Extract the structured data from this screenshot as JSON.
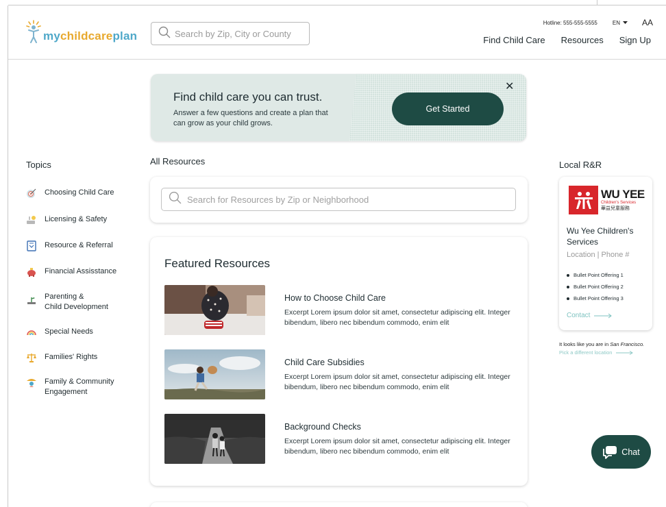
{
  "header": {
    "logo": {
      "part1": "my",
      "part2": "childcare",
      "part3": "plan"
    },
    "search_placeholder": "Search by Zip, City or County",
    "hotline": "Hotline: 555-555-5555",
    "language": "EN",
    "text_size": "AA",
    "nav": [
      "Find Child Care",
      "Resources",
      "Sign Up"
    ]
  },
  "banner": {
    "title": "Find child care you can trust.",
    "text": "Answer a few questions and create a plan that can grow as your child grows.",
    "cta": "Get Started",
    "close": "✕"
  },
  "topics": {
    "title": "Topics",
    "items": [
      {
        "label": "Choosing Child Care",
        "icon": "target-icon"
      },
      {
        "label": "Licensing & Safety",
        "icon": "license-icon"
      },
      {
        "label": "Resource & Referral",
        "icon": "referral-icon"
      },
      {
        "label": "Financial Assisstance",
        "icon": "piggy-bank-icon"
      },
      {
        "label": "Parenting &\nChild Development",
        "icon": "plant-icon"
      },
      {
        "label": "Special Needs",
        "icon": "rainbow-icon"
      },
      {
        "label": "Families' Rights",
        "icon": "scales-icon"
      },
      {
        "label": "Family & Community\nEngagement",
        "icon": "community-icon"
      }
    ]
  },
  "resources": {
    "title": "All Resources",
    "search_placeholder": "Search for Resources by Zip or Neighborhood",
    "featured_title": "Featured Resources",
    "articles": [
      {
        "title": "How to Choose Child Care",
        "text": "Excerpt Lorem ipsum dolor sit amet, consectetur adipiscing elit. Integer bibendum, libero nec bibendum commodo, enim elit"
      },
      {
        "title": "Child Care Subsidies",
        "text": "Excerpt Lorem ipsum dolor sit amet, consectetur adipiscing elit. Integer bibendum, libero nec bibendum commodo, enim elit"
      },
      {
        "title": "Background Checks",
        "text": "Excerpt Lorem ipsum dolor sit amet, consectetur adipiscing elit. Integer bibendum, libero nec bibendum commodo, enim elit"
      }
    ]
  },
  "local": {
    "title": "Local R&R",
    "logo_name": "WU YEE",
    "logo_sub": "Children's Services",
    "logo_zh": "華益兒童服務",
    "name": "Wu Yee Children's Services",
    "location": "Location | Phone #",
    "bullets": [
      "Bullet Point Offering 1",
      "Bullet Point Offering 2",
      "Bullet Point Offering 3"
    ],
    "contact": "Contact",
    "note_prefix": "It looks like you are in ",
    "note_city": "San Francisco.",
    "change_link": "Pick a different location"
  },
  "chat": {
    "label": "Chat"
  },
  "colors": {
    "brand_dark": "#1e4b44",
    "accent_blue": "#4fa8c9",
    "accent_orange": "#e8a92e",
    "link_teal": "#7fc3c0",
    "wu_yee_red": "#d8262b"
  }
}
